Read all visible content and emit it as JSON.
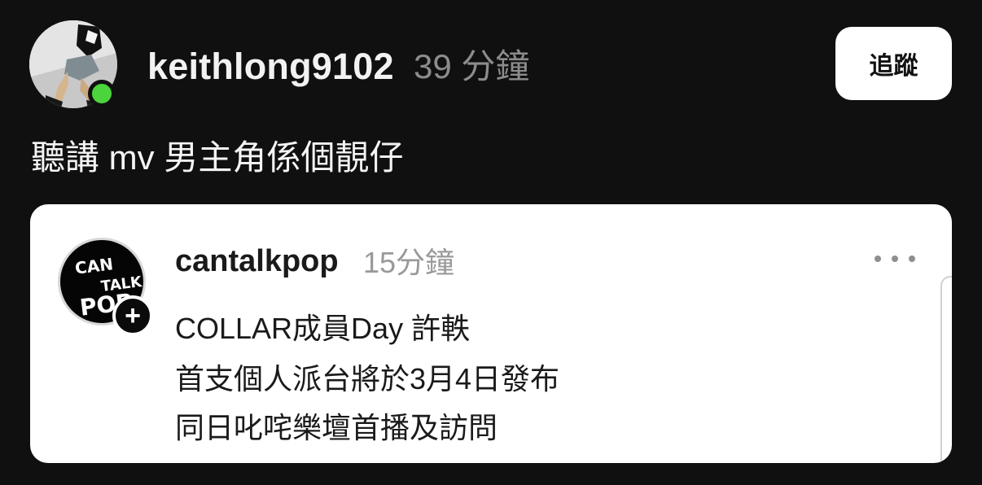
{
  "post": {
    "author": {
      "username": "keithlong9102",
      "time": "39 分鐘",
      "online_status_color": "#4cd43c",
      "avatar_icon": "profile-photo-icon"
    },
    "follow_label": "追蹤",
    "text": "聽講 mv 男主角係個靚仔"
  },
  "quoted_post": {
    "author": {
      "username": "cantalkpop",
      "time": "15分鐘",
      "avatar_icon": "cantalkpop-logo-icon",
      "logo_text": {
        "line1": "CAN",
        "line2": "TALK",
        "line3": "POP"
      }
    },
    "more_icon": "more-horizontal-icon",
    "plus_icon": "plus-icon",
    "lines": [
      "COLLAR成員Day 許軼",
      "首支個人派台將於3月4日發布",
      "同日叱咤樂壇首播及訪問"
    ]
  }
}
